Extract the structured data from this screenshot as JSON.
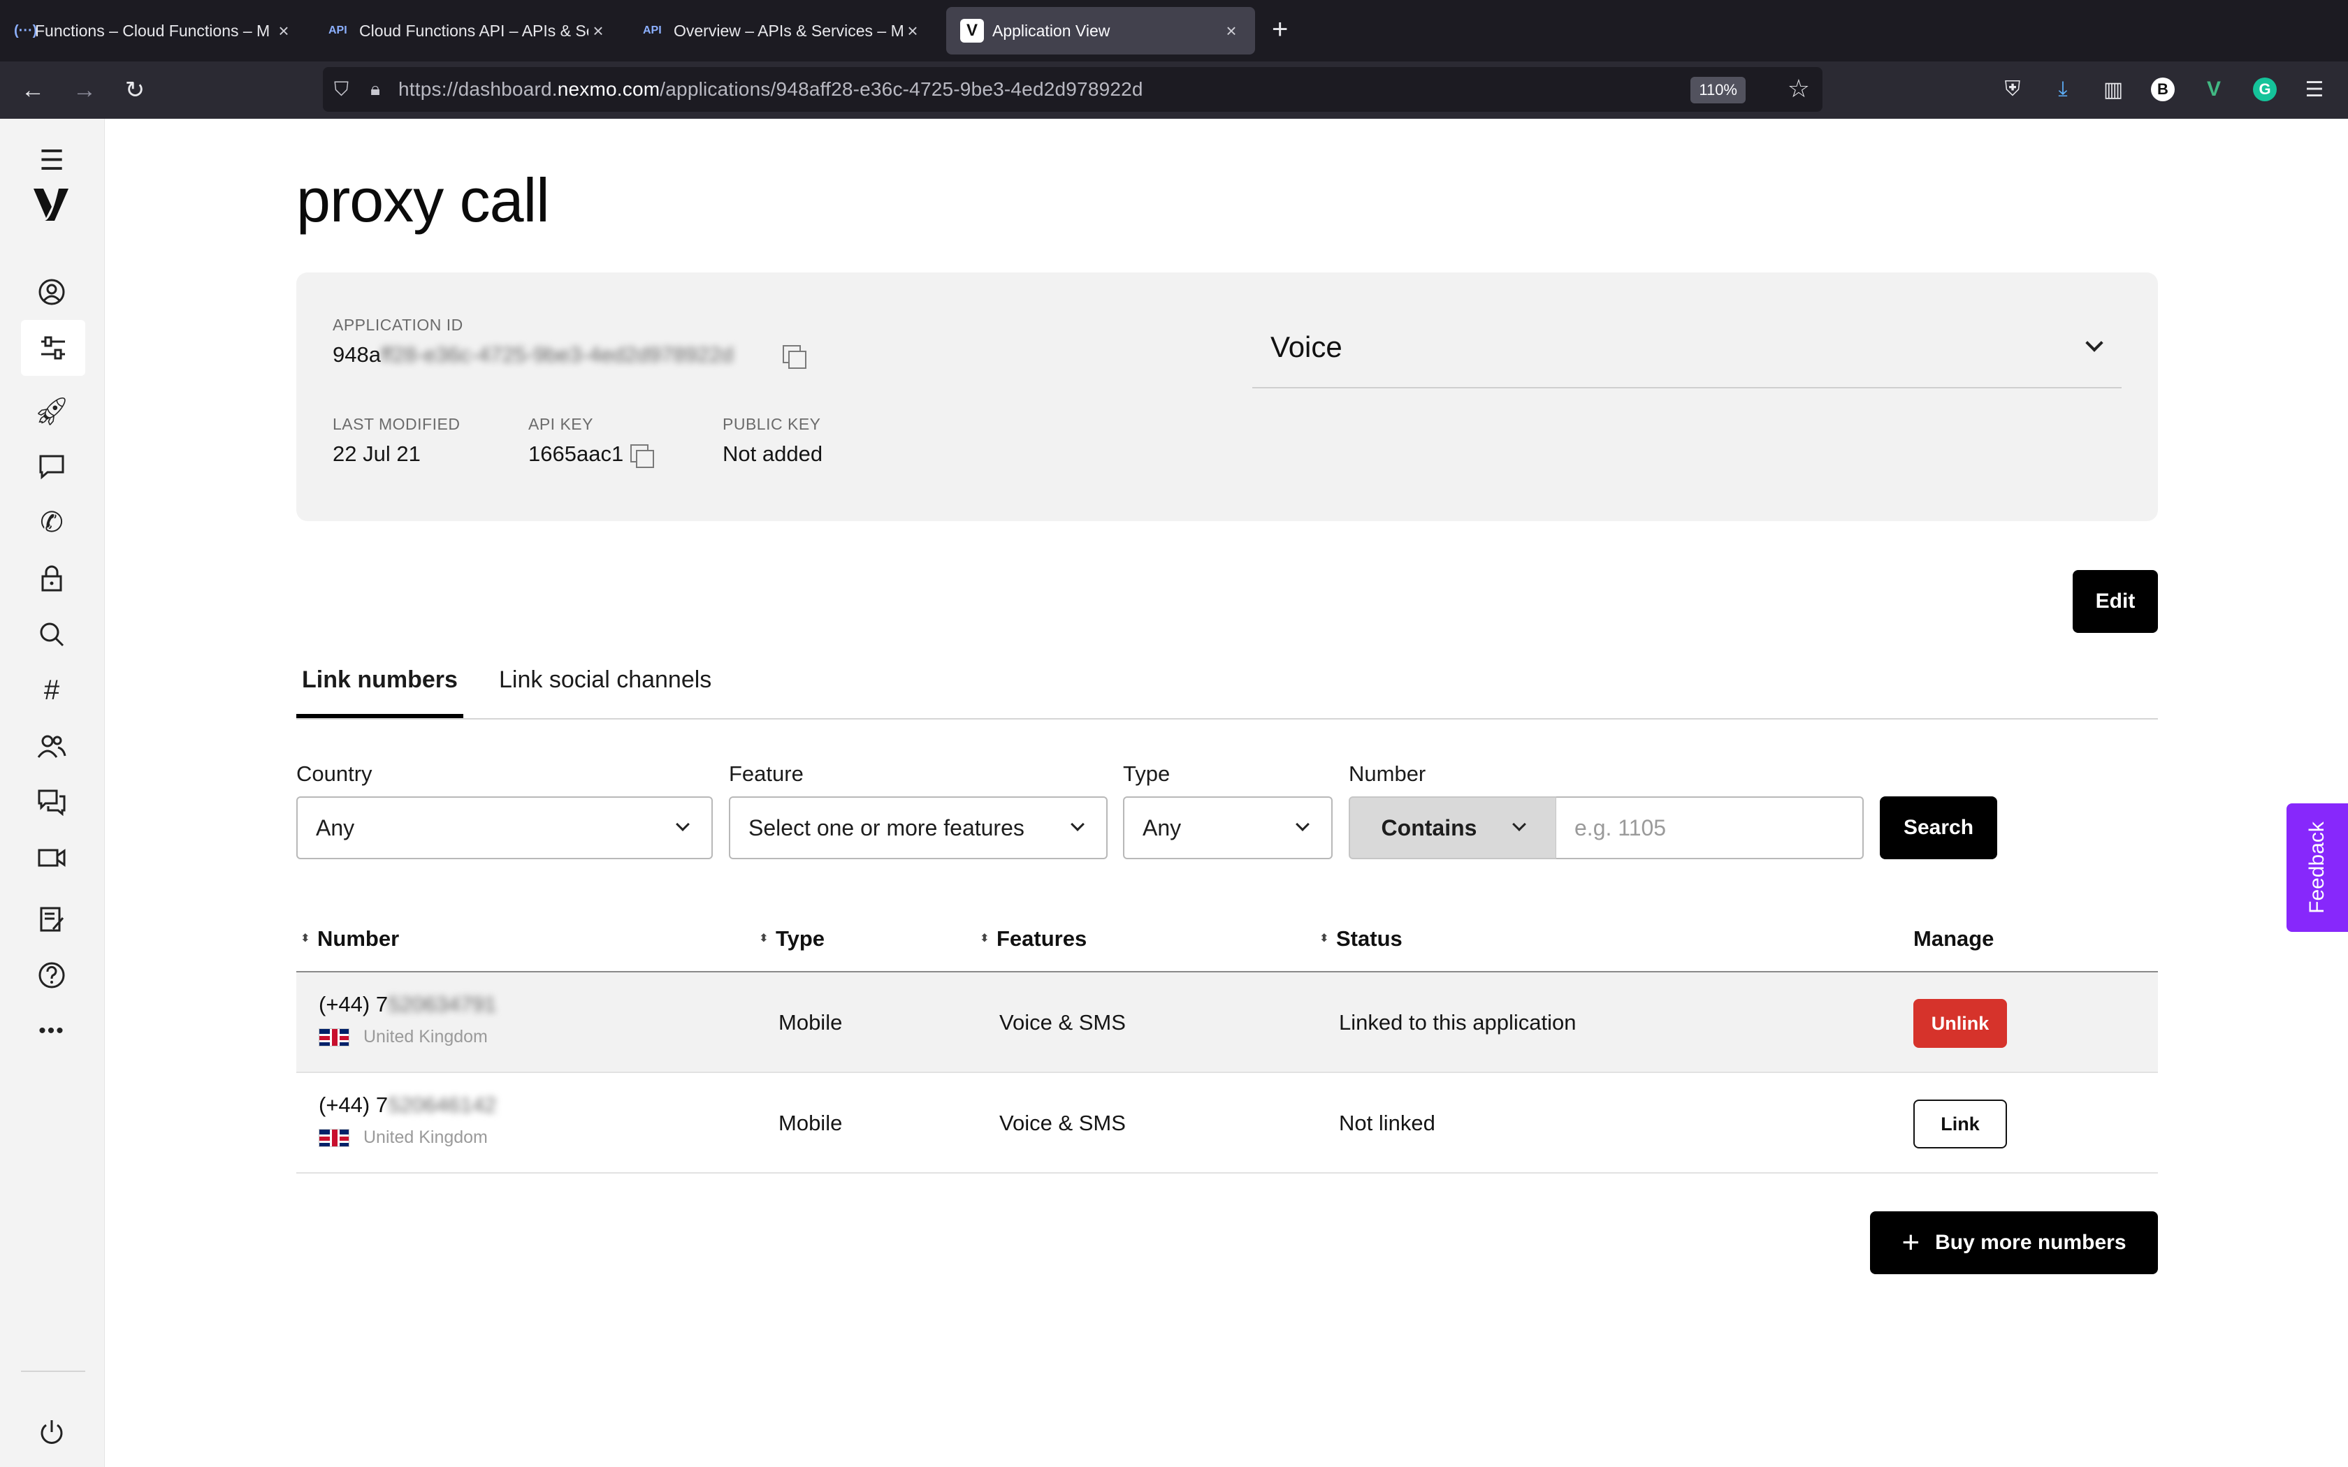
{
  "browser": {
    "tabs": [
      {
        "icon": "(···)",
        "title": "Functions – Cloud Functions – M"
      },
      {
        "icon": "API",
        "title": "Cloud Functions API – APIs & Se"
      },
      {
        "icon": "API",
        "title": "Overview – APIs & Services – My"
      },
      {
        "icon": "V",
        "title": "Application View"
      }
    ],
    "new_tab": "+",
    "url_prefix": "https://dashboard.",
    "url_domain": "nexmo.com",
    "url_path": "/applications/948aff28-e36c-4725-9be3-4ed2d978922d",
    "zoom": "110%",
    "profile_letter": "B",
    "ext_v": "V",
    "ext_g": "G"
  },
  "page": {
    "title": "proxy call",
    "app_id_label": "APPLICATION ID",
    "app_id_visible": "948a",
    "app_id_hidden": "ff28-e36c-4725-9be3-4ed2d978922d",
    "last_modified_label": "LAST MODIFIED",
    "last_modified": "22 Jul 21",
    "api_key_label": "API KEY",
    "api_key": "1665aac1",
    "public_key_label": "PUBLIC KEY",
    "public_key": "Not added",
    "capability": "Voice",
    "edit_label": "Edit"
  },
  "tabs": {
    "link_numbers": "Link numbers",
    "link_social": "Link social channels"
  },
  "filters": {
    "country_label": "Country",
    "country_value": "Any",
    "feature_label": "Feature",
    "feature_value": "Select one or more features",
    "type_label": "Type",
    "type_value": "Any",
    "number_label": "Number",
    "contains_value": "Contains",
    "number_placeholder": "e.g. 1105",
    "search_label": "Search"
  },
  "table": {
    "headers": {
      "number": "Number",
      "type": "Type",
      "features": "Features",
      "status": "Status",
      "manage": "Manage"
    },
    "rows": [
      {
        "number_visible": "(+44) 7",
        "number_hidden": "520634791",
        "country": "United Kingdom",
        "type": "Mobile",
        "features": "Voice & SMS",
        "status": "Linked to this application",
        "action": "Unlink"
      },
      {
        "number_visible": "(+44) 7",
        "number_hidden": "520646142",
        "country": "United Kingdom",
        "type": "Mobile",
        "features": "Voice & SMS",
        "status": "Not linked",
        "action": "Link"
      }
    ]
  },
  "buy_more_label": "Buy more numbers",
  "feedback_label": "Feedback",
  "colors": {
    "accent": "#8728fb",
    "unlink": "#d6332b",
    "card_bg": "#f2f2f2",
    "dark_button": "#000000"
  }
}
